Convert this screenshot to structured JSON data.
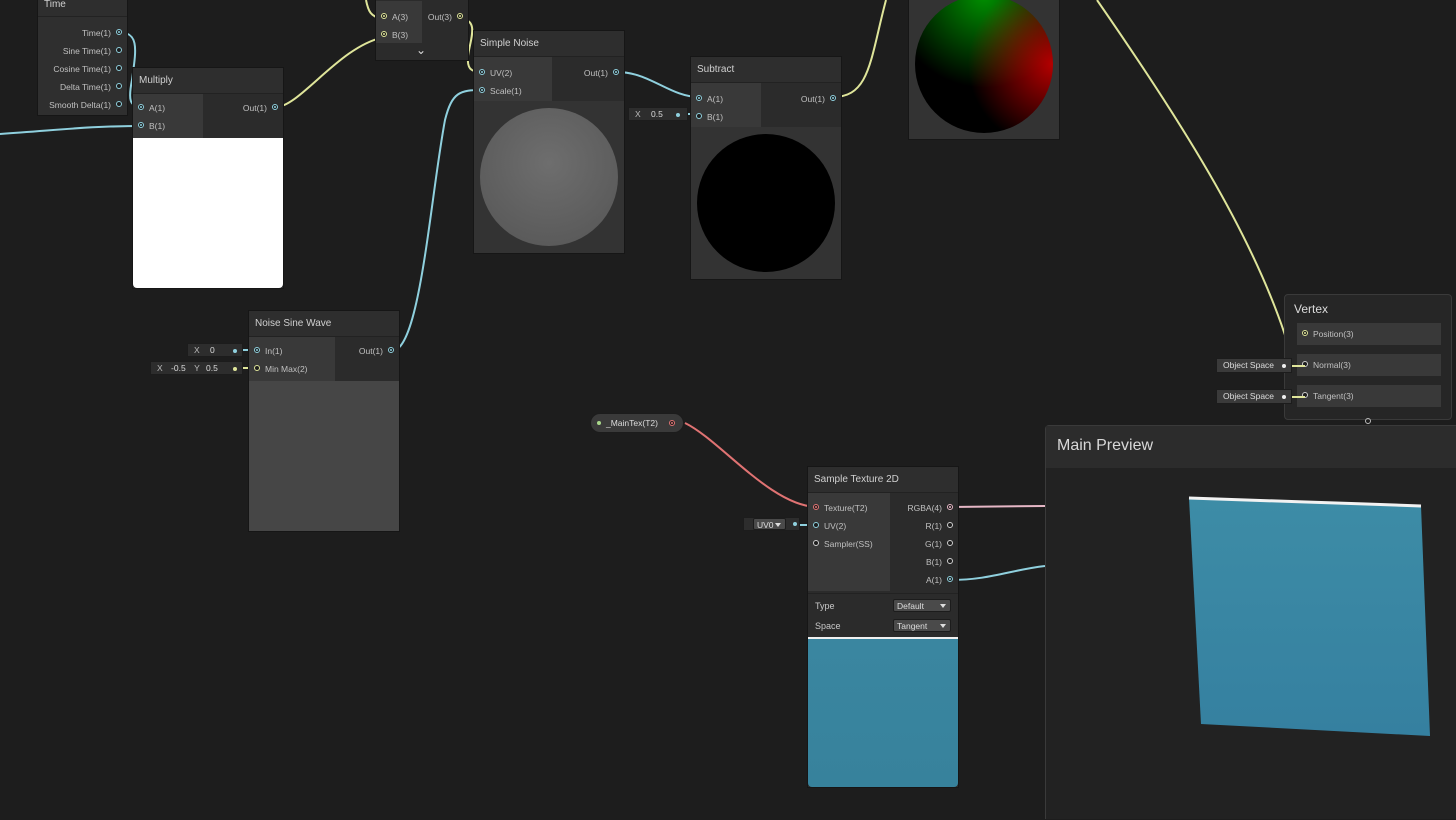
{
  "nodes": {
    "time": {
      "title": "Time",
      "outputs": [
        "Time(1)",
        "Sine Time(1)",
        "Cosine Time(1)",
        "Delta Time(1)",
        "Smooth Delta(1)"
      ]
    },
    "add": {
      "inputs": [
        "A(3)",
        "B(3)"
      ],
      "outputs": [
        "Out(3)"
      ],
      "collapse_glyph": "⌄"
    },
    "multiply": {
      "title": "Multiply",
      "inputs": [
        "A(1)",
        "B(1)"
      ],
      "outputs": [
        "Out(1)"
      ]
    },
    "simple_noise": {
      "title": "Simple Noise",
      "inputs": [
        "UV(2)",
        "Scale(1)"
      ],
      "outputs": [
        "Out(1)"
      ]
    },
    "subtract": {
      "title": "Subtract",
      "inputs": [
        "A(1)",
        "B(1)"
      ],
      "outputs": [
        "Out(1)"
      ],
      "b_field": {
        "label": "X",
        "value": "0.5"
      }
    },
    "noise_sine_wave": {
      "title": "Noise Sine Wave",
      "inputs": [
        "In(1)",
        "Min Max(2)"
      ],
      "outputs": [
        "Out(1)"
      ],
      "in_field": {
        "label": "X",
        "value": "0"
      },
      "minmax_field": {
        "xlabel": "X",
        "xvalue": "-0.5",
        "ylabel": "Y",
        "yvalue": "0.5"
      }
    },
    "main_tex": {
      "label": "_MainTex(T2)"
    },
    "sample_texture": {
      "title": "Sample Texture 2D",
      "inputs": [
        "Texture(T2)",
        "UV(2)",
        "Sampler(SS)"
      ],
      "outputs": [
        "RGBA(4)",
        "R(1)",
        "G(1)",
        "B(1)",
        "A(1)"
      ],
      "uv_dropdown": "UV0",
      "type_label": "Type",
      "type_value": "Default",
      "space_label": "Space",
      "space_value": "Tangent"
    },
    "vertex": {
      "title": "Vertex",
      "ports": [
        "Position(3)",
        "Normal(3)",
        "Tangent(3)"
      ],
      "normal_space": "Object Space",
      "tangent_space": "Object Space"
    }
  },
  "main_preview": {
    "title": "Main Preview"
  },
  "colors": {
    "background": "#1d1d1d",
    "wire_float": "#8fd0de",
    "wire_vector3": "#dfe59a",
    "wire_texture": "#e07373",
    "wire_vector4": "#e6b7c6",
    "preview_teal": "#3a86a0"
  }
}
